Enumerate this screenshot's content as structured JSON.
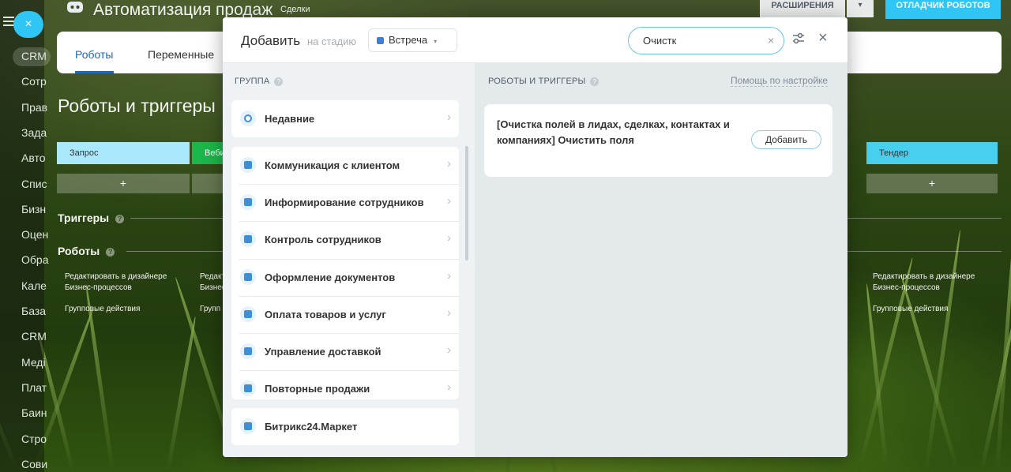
{
  "app": {
    "title": "Автоматизация продаж",
    "subtitle": "Сделки",
    "extensions_label": "РАСШИРЕНИЯ",
    "extensions_dropdown": "▾",
    "debugger_label": "ОТЛАДЧИК РОБОТОВ"
  },
  "left_rail": {
    "close": "×",
    "items": [
      "CRM",
      "Сотр",
      "Прав",
      "Зада",
      "Авто",
      "Спис",
      "Бизн",
      "Оцен",
      "Обра",
      "Кале",
      "База",
      "CRM",
      "Меді",
      "Плат",
      "Баин",
      "Стро",
      "Сови"
    ]
  },
  "tabs": [
    "Роботы",
    "Переменные"
  ],
  "section_title": "Роботы и триггеры",
  "stages": [
    {
      "label": "Запрос",
      "color": "#a9e9fb",
      "text_color": "#333333"
    },
    {
      "label": "Веби",
      "color": "#1bb74a",
      "text_color": "#ffffff"
    },
    {
      "label": "Тендер",
      "color": "#48cfee",
      "text_color": "#333333"
    }
  ],
  "stage_add": "+",
  "triggers_label": "Триггеры",
  "robots_label": "Роботы",
  "help_mark": "?",
  "column_links": {
    "edit_designer": "Редактировать в дизайнере Бизнес-процессов",
    "edit_designer_cut": "Редакт\nБизнес",
    "group_actions": "Групповые действия",
    "group_actions_cut": "Групп"
  },
  "modal": {
    "title": "Добавить",
    "stage_label": "на стадию",
    "stage_value": "Встреча",
    "stage_caret": "▾",
    "search_value": "Очистк",
    "search_clear": "×",
    "close": "×",
    "group_header": "ГРУППА",
    "robots_header": "РОБОТЫ И ТРИГГЕРЫ",
    "help_link": "Помощь по настройке",
    "chevron": "›",
    "recent": {
      "label": "Недавние",
      "icon": "clock-icon"
    },
    "groups": [
      {
        "label": "Коммуникация с клиентом",
        "icon": "chat-icon"
      },
      {
        "label": "Информирование сотрудников",
        "icon": "info-icon"
      },
      {
        "label": "Контроль сотрудников",
        "icon": "people-icon"
      },
      {
        "label": "Оформление документов",
        "icon": "document-icon"
      },
      {
        "label": "Оплата товаров и услуг",
        "icon": "wallet-icon"
      },
      {
        "label": "Управление доставкой",
        "icon": "truck-icon"
      },
      {
        "label": "Повторные продажи",
        "icon": "repeat-sale-icon"
      }
    ],
    "market": {
      "label": "Битрикс24.Маркет",
      "icon": "market-icon"
    },
    "result": {
      "text": "[Очистка полей в лидах, сделках, контактах и компаниях] Очистить поля",
      "add_label": "Добавить"
    }
  },
  "colors": {
    "accent": "#2fc6f6",
    "tab_active": "#2067b0",
    "stage_dot": "#3f7ed6"
  }
}
